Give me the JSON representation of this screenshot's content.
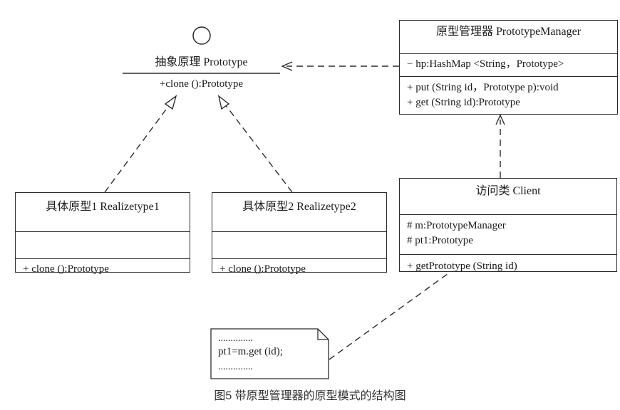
{
  "prototype_interface": {
    "name": "抽象原理  Prototype",
    "operation": "+clone ():Prototype"
  },
  "prototype_manager": {
    "title": "原型管理器  PrototypeManager",
    "attribute": "− hp:HashMap <String，Prototype>",
    "operations": [
      "+ put (String id，Prototype p):void",
      "+ get (String id):Prototype"
    ]
  },
  "realize1": {
    "title": "具体原型1 Realizetype1",
    "operation": "+ clone ():Prototype"
  },
  "realize2": {
    "title": "具体原型2 Realizetype2",
    "operation": "+ clone ():Prototype"
  },
  "client": {
    "title": "访问类  Client",
    "attributes": [
      "# m:PrototypeManager",
      "# pt1:Prototype"
    ],
    "operation": "+ getPrototype (String id)"
  },
  "note": {
    "lines": [
      "..............",
      "pt1=m.get (id);",
      ".............."
    ]
  },
  "caption": "图5 带原型管理器的原型模式的结构图",
  "colors": {
    "line": "#2b2b2b",
    "caption": "#333333"
  }
}
